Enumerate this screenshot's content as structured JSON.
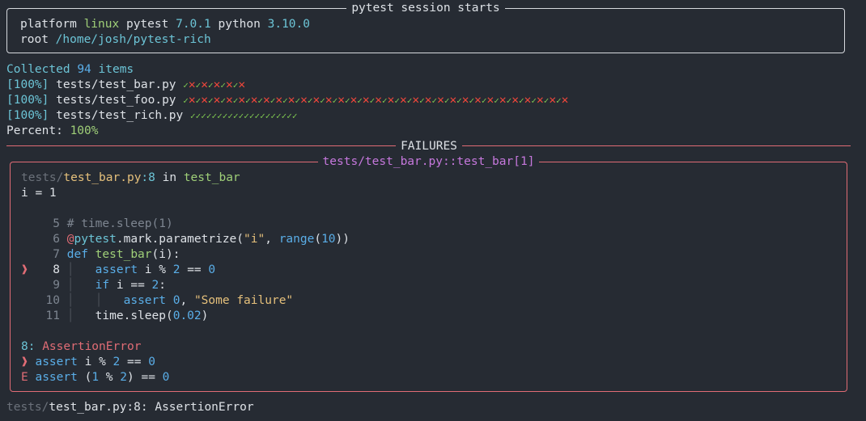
{
  "session": {
    "title": "pytest session starts",
    "platform_label": "platform",
    "platform": "linux",
    "pytest_label": "pytest",
    "pytest_version": "7.0.1",
    "python_label": "python",
    "python_version": "3.10.0",
    "root_label": "root",
    "root_path": "/home/josh/pytest-rich"
  },
  "collected": {
    "prefix": "Collected",
    "count": "94",
    "suffix": "items"
  },
  "results": [
    {
      "pct": "[100%]",
      "file": "tests/test_bar.py",
      "marks": "pfpfpfpfpf"
    },
    {
      "pct": "[100%]",
      "file": "tests/test_foo.py",
      "marks": "pfpfpfpfpfpfpfpfpfpfpfpfpfpfpfpfpfpfpfpfpfpfpfpfpfpfpfpfpfpfpf"
    },
    {
      "pct": "[100%]",
      "file": "tests/test_rich.py",
      "marks": "pppppppppppppppppppp"
    }
  ],
  "percent": {
    "label": "Percent:",
    "value": "100%"
  },
  "failures": {
    "title": "FAILURES",
    "test_title": "tests/test_bar.py::test_bar[1]",
    "location_dir": "tests/",
    "location_file": "test_bar.py",
    "location_line": ":8",
    "location_in": " in ",
    "location_func": "test_bar",
    "local_var": "i = 1",
    "code": [
      {
        "n": "5",
        "text": "# time.sleep(1)"
      },
      {
        "n": "6",
        "text": "@pytest.mark.parametrize(\"i\", range(10))"
      },
      {
        "n": "7",
        "text": "def test_bar(i):"
      },
      {
        "n": "8",
        "text": "assert i % 2 == 0"
      },
      {
        "n": "9",
        "text": "if i == 2:"
      },
      {
        "n": "10",
        "text": "assert 0, \"Some failure\""
      },
      {
        "n": "11",
        "text": "time.sleep(0.02)"
      }
    ],
    "error_line": "8",
    "error_name": "AssertionError",
    "pointer_line": "assert i % 2 == 0",
    "explain_prefix": "E",
    "explain_line": "assert (1 % 2) == 0"
  },
  "summary": {
    "dir": "tests/",
    "rest": "test_bar.py:8: AssertionError"
  },
  "colors": {
    "background": "#262b33",
    "pass": "#7ec650",
    "fail": "#f0473b",
    "failure_border": "#e06c75",
    "title_purple": "#c678dd"
  }
}
